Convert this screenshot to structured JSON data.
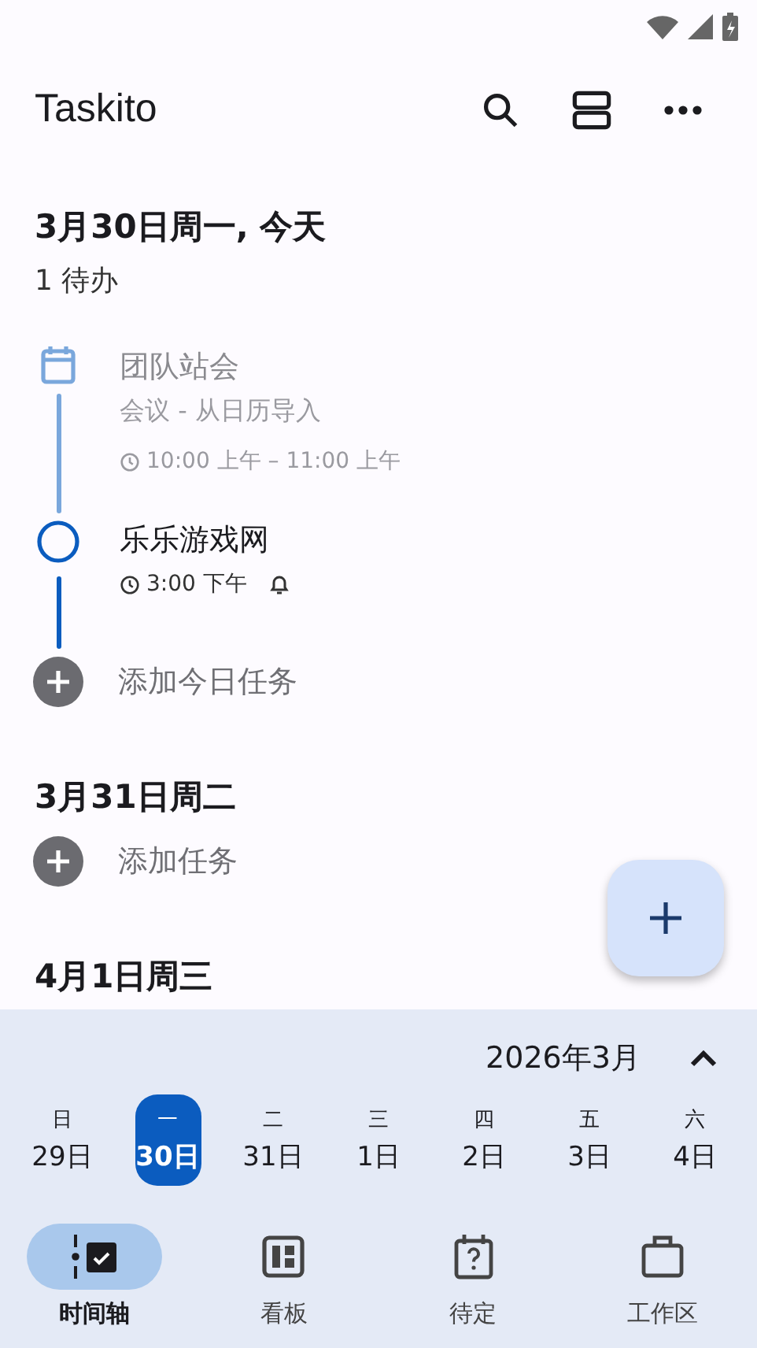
{
  "app_bar": {
    "title": "Taskito"
  },
  "days": [
    {
      "heading": "3月30日周一, 今天",
      "count": "1 待办",
      "items": [
        {
          "kind": "event",
          "title": "团队站会",
          "subtitle": "会议 - 从日历导入",
          "time": "10:00 上午 – 11:00 上午"
        },
        {
          "kind": "task",
          "title": "乐乐游戏网",
          "time": "3:00 下午",
          "reminder": true,
          "done": false
        }
      ],
      "add_label": "添加今日任务"
    },
    {
      "heading": "3月31日周二",
      "add_label": "添加任务"
    },
    {
      "heading": "4月1日周三"
    }
  ],
  "calendar": {
    "month": "2026年3月",
    "days": [
      {
        "weekday": "日",
        "date": "29日",
        "selected": false
      },
      {
        "weekday": "一",
        "date": "30日",
        "selected": true
      },
      {
        "weekday": "二",
        "date": "31日",
        "selected": false
      },
      {
        "weekday": "三",
        "date": "1日",
        "selected": false
      },
      {
        "weekday": "四",
        "date": "2日",
        "selected": false
      },
      {
        "weekday": "五",
        "date": "3日",
        "selected": false
      },
      {
        "weekday": "六",
        "date": "4日",
        "selected": false
      }
    ]
  },
  "bottom_nav": [
    {
      "label": "时间轴",
      "selected": true
    },
    {
      "label": "看板",
      "selected": false
    },
    {
      "label": "待定",
      "selected": false
    },
    {
      "label": "工作区",
      "selected": false
    }
  ]
}
